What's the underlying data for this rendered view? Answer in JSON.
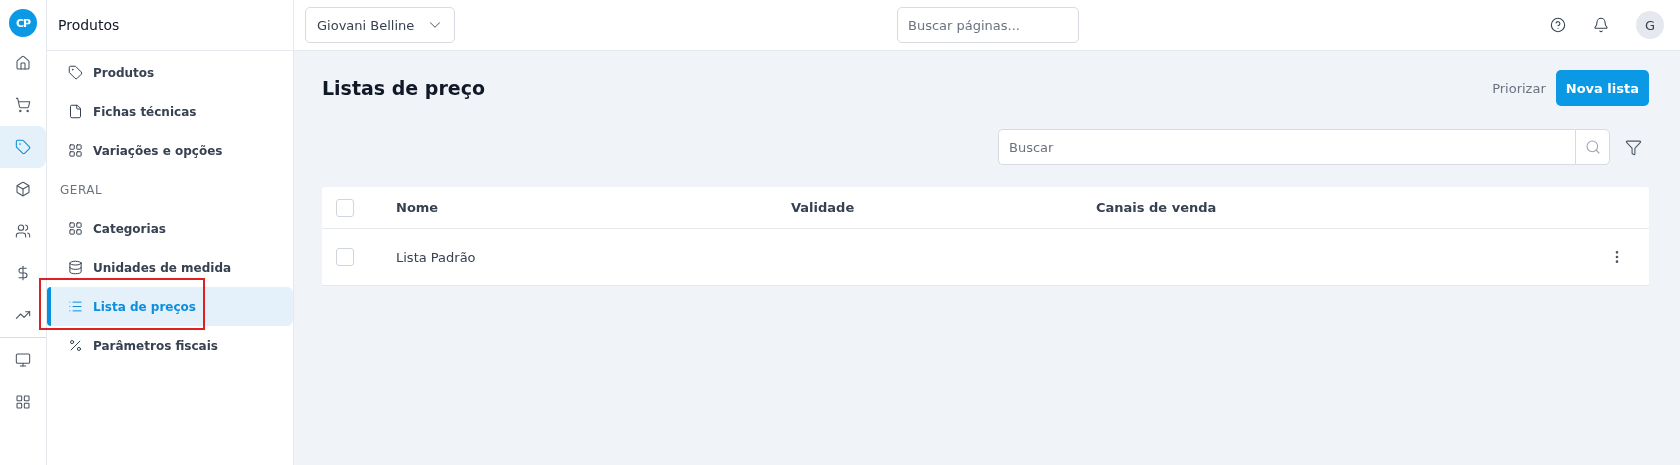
{
  "logo": {
    "text": "CP"
  },
  "rail": [
    {
      "selected": false
    },
    {
      "selected": false
    },
    {
      "selected": true
    },
    {
      "selected": false
    },
    {
      "selected": false
    },
    {
      "selected": false
    },
    {
      "selected": false
    },
    {
      "selected": false
    },
    {
      "selected": false
    }
  ],
  "sidebar": {
    "title": "Produtos",
    "sections": [
      {
        "items": [
          {
            "label": "Produtos",
            "selected": false,
            "highlighted": false
          },
          {
            "label": "Fichas técnicas",
            "selected": false,
            "highlighted": false
          },
          {
            "label": "Variações e opções",
            "selected": false,
            "highlighted": false
          }
        ]
      },
      {
        "heading": "GERAL",
        "items": [
          {
            "label": "Categorias",
            "selected": false,
            "highlighted": false
          },
          {
            "label": "Unidades de medida",
            "selected": false,
            "highlighted": false
          },
          {
            "label": "Lista de preços",
            "selected": true,
            "highlighted": true
          },
          {
            "label": "Parâmetros fiscais",
            "selected": false,
            "highlighted": false
          }
        ]
      }
    ]
  },
  "topbar": {
    "account": "Giovani Belline",
    "search": {
      "placeholder": "Buscar páginas..."
    },
    "avatar": "G"
  },
  "page": {
    "title": "Listas de preço",
    "secondary_action": "Priorizar",
    "primary_action": "Nova lista",
    "search": {
      "placeholder": "Buscar"
    }
  },
  "table": {
    "columns": [
      "Nome",
      "Validade",
      "Canais de venda"
    ],
    "rows": [
      {
        "cells": [
          "Lista Padrão",
          "",
          ""
        ],
        "checked": false
      }
    ],
    "all_checked": false
  }
}
